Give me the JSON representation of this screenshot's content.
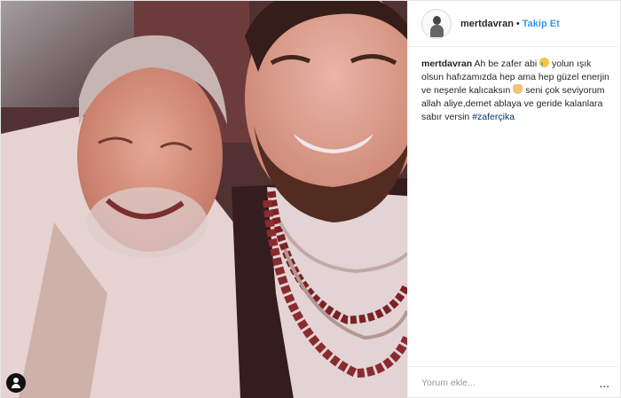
{
  "header": {
    "username": "mertdavran",
    "separator": "•",
    "follow_label": "Takip Et"
  },
  "caption": {
    "username": "mertdavran",
    "text_1": "Ah be zafer abi",
    "text_2": "yolun ışık olsun hafızamızda hep ama hep güzel enerjin ve neşenle kalıcaksın",
    "text_3": "seni çok seviyorum allah aliye,demet ablaya ve geride kalanlara sabır versin",
    "hashtag": "#zaferçika"
  },
  "footer": {
    "comment_placeholder": "Yorum ekle...",
    "more_icon": "..."
  },
  "icons": {
    "avatar": "profile-avatar",
    "user_tag": "user-tag-icon",
    "emoji_1": "crying-face-emoji",
    "emoji_2": "folded-hands-emoji"
  },
  "colors": {
    "follow": "#3897f0",
    "hashtag": "#003569",
    "border": "#efefef"
  }
}
